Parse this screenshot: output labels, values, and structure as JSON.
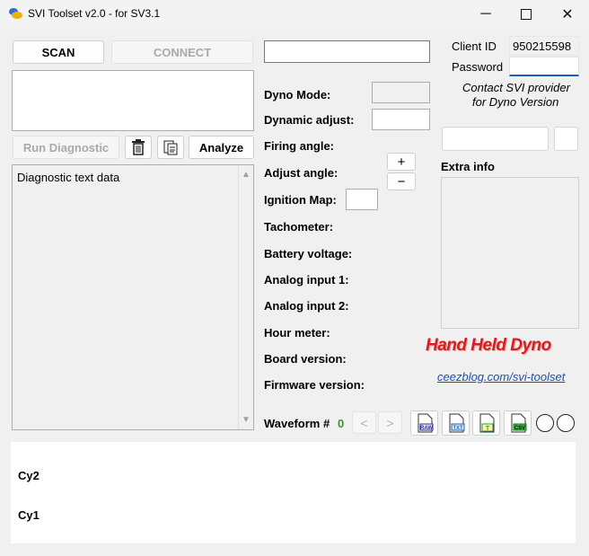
{
  "window": {
    "title": "SVI Toolset v2.0 - for SV3.1",
    "minimize": "─",
    "maximize": "☐",
    "close": "✕"
  },
  "toolbar": {
    "scan_label": "SCAN",
    "connect_label": "CONNECT"
  },
  "diagnostic": {
    "run_label": "Run Diagnostic",
    "analyze_label": "Analyze",
    "text": "Diagnostic text data",
    "scroll_up": "▲",
    "scroll_down": "▼"
  },
  "auth": {
    "client_id_label": "Client ID",
    "client_id_value": "950215598",
    "password_label": "Password",
    "password_value": "",
    "contact_line1": "Contact SVI provider",
    "contact_line2": "for Dyno Version"
  },
  "params": {
    "dyno_mode": "Dyno Mode:",
    "dynamic_adjust": "Dynamic adjust:",
    "firing_angle": "Firing angle:",
    "adjust_angle": "Adjust angle:",
    "plus": "+",
    "minus": "−",
    "ignition_map": "Ignition Map:",
    "tachometer": "Tachometer:",
    "battery_voltage": "Battery voltage:",
    "analog_input_1": "Analog input 1:",
    "analog_input_2": "Analog input 2:",
    "hour_meter": "Hour meter:",
    "board_version": "Board version:",
    "firmware_version": "Firmware version:"
  },
  "extra": {
    "label": "Extra info"
  },
  "brand": {
    "logo_text": "Hand Held Dyno",
    "link_text": "ceezblog.com/svi-toolset"
  },
  "waveform": {
    "label": "Waveform #",
    "number": "0",
    "prev": "<",
    "next": ">",
    "export_raw": "RAW",
    "export_txt": "TXT",
    "export_t": "T",
    "export_csv": "CSV"
  },
  "plot": {
    "cy2": "Cy2",
    "cy1": "Cy1"
  },
  "colors": {
    "waveform_number": "#2a9a2a",
    "logo_red": "#d42020",
    "link_blue": "#1a4fb5",
    "focus_blue": "#1a5fb4"
  }
}
